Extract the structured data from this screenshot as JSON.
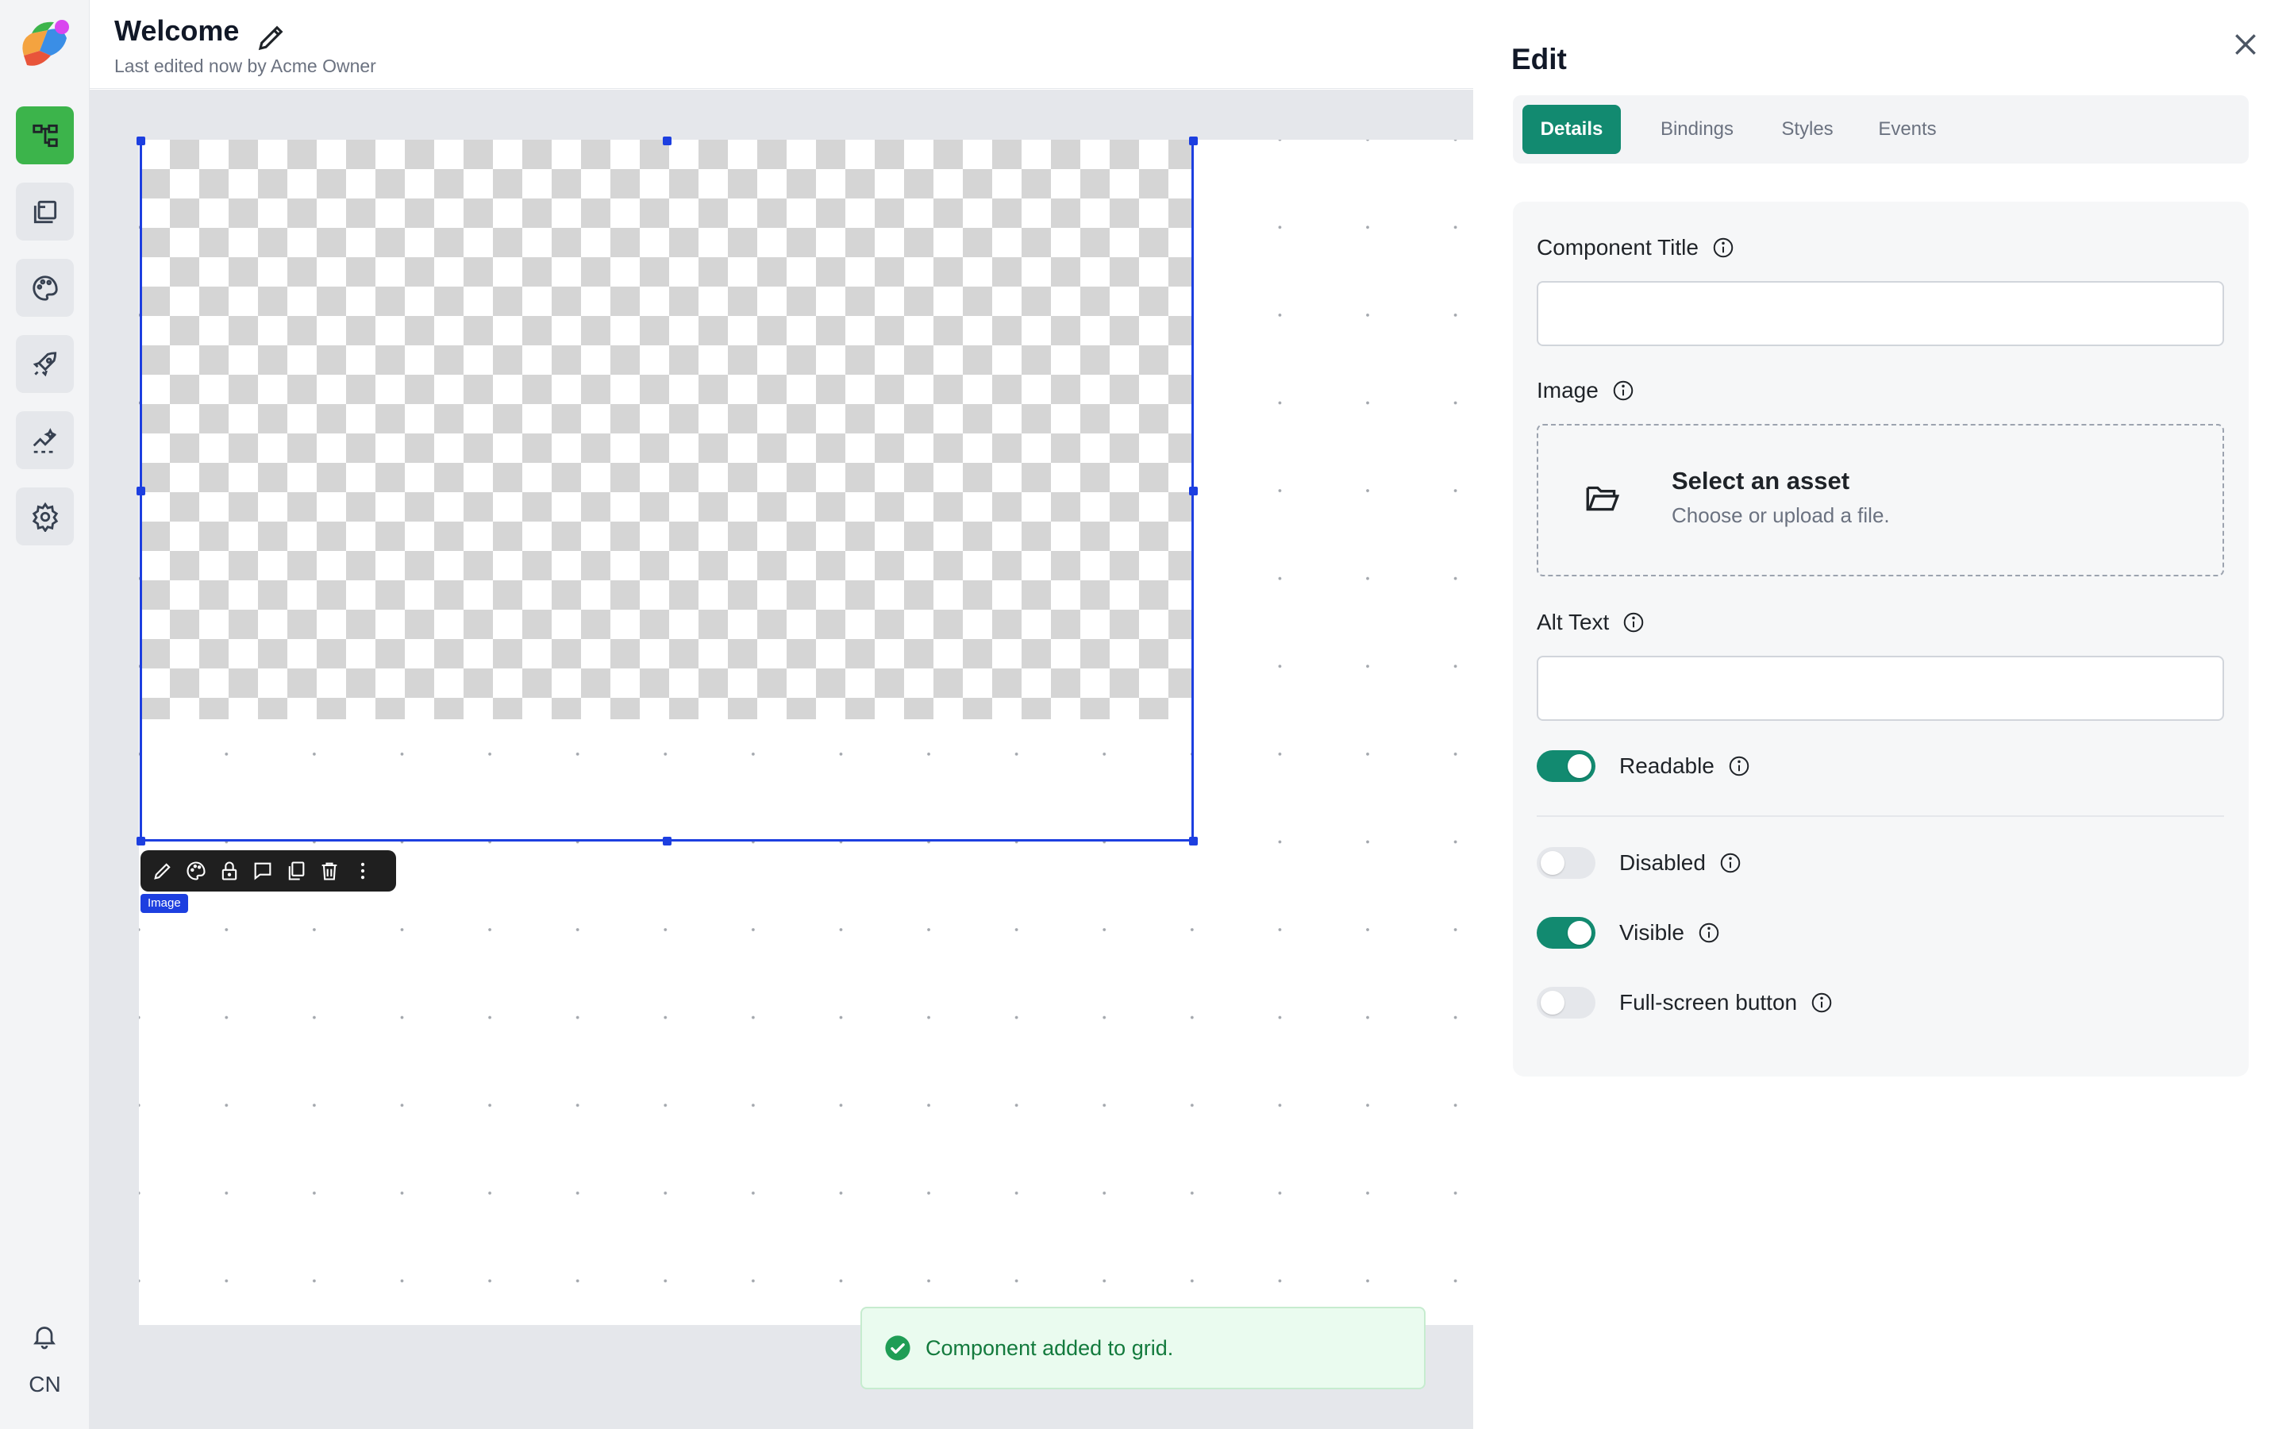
{
  "header": {
    "title": "Welcome",
    "subtitle": "Last edited now by Acme Owner"
  },
  "rail": {
    "items": [
      {
        "icon": "hierarchy-icon",
        "active": true
      },
      {
        "icon": "pages-icon",
        "active": false
      },
      {
        "icon": "palette-icon",
        "active": false
      },
      {
        "icon": "rocket-icon",
        "active": false
      },
      {
        "icon": "analytics-icon",
        "active": false
      },
      {
        "icon": "gear-icon",
        "active": false
      }
    ],
    "initials": "CN"
  },
  "canvas": {
    "component_tag": "Image",
    "toolbar_icons": [
      "pencil-icon",
      "palette-icon",
      "lock-icon",
      "comment-icon",
      "copy-icon",
      "trash-icon",
      "more-icon"
    ]
  },
  "toast": {
    "message": "Component added to grid."
  },
  "panel": {
    "title": "Edit",
    "tabs": [
      {
        "label": "Details",
        "active": true
      },
      {
        "label": "Bindings",
        "active": false
      },
      {
        "label": "Styles",
        "active": false
      },
      {
        "label": "Events",
        "active": false
      }
    ],
    "fields": {
      "component_title": {
        "label": "Component Title",
        "value": ""
      },
      "image": {
        "label": "Image",
        "asset_title": "Select an asset",
        "asset_subtitle": "Choose or upload a file."
      },
      "alt_text": {
        "label": "Alt Text",
        "value": ""
      }
    },
    "toggles": [
      {
        "label": "Readable",
        "on": true
      },
      {
        "label": "Disabled",
        "on": false
      },
      {
        "label": "Visible",
        "on": true
      },
      {
        "label": "Full-screen button",
        "on": false
      }
    ]
  },
  "colors": {
    "accent": "#128a70",
    "rail_active": "#3cb44b",
    "selection": "#1d3fe0",
    "toast_text": "#137a3d"
  }
}
